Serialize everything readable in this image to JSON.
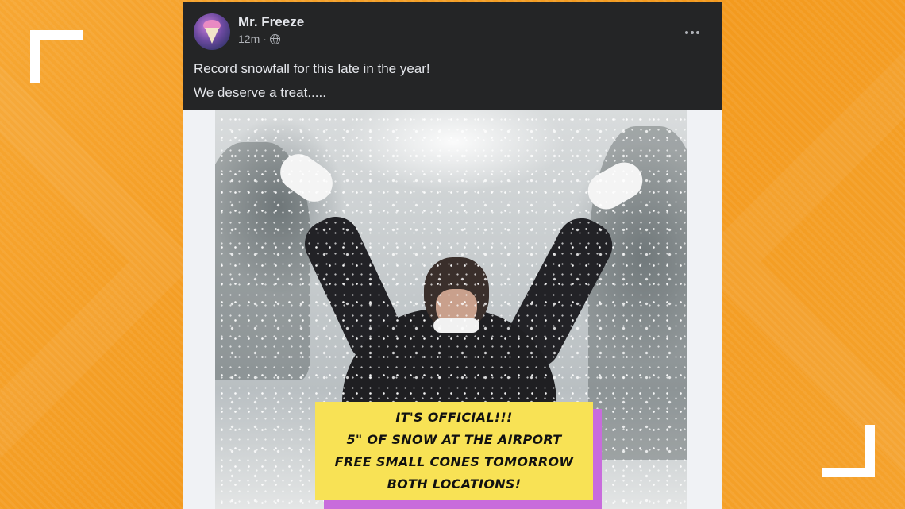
{
  "post": {
    "author": "Mr. Freeze",
    "time": "12m",
    "separator": "·",
    "privacy_icon": "globe-icon",
    "more_icon": "more-horizontal-icon",
    "text_lines": [
      "Record snowfall for this late in the year!",
      "We deserve a treat....."
    ]
  },
  "image": {
    "sign_lines": [
      "IT'S OFFICIAL!!!",
      "5\" OF SNOW AT THE AIRPORT",
      "FREE SMALL CONES TOMORROW",
      "BOTH LOCATIONS!"
    ]
  },
  "colors": {
    "frame_background": "#f5a02a",
    "post_header": "#242526",
    "sign_yellow": "#f8e255",
    "sign_purple": "#c86cdc"
  }
}
